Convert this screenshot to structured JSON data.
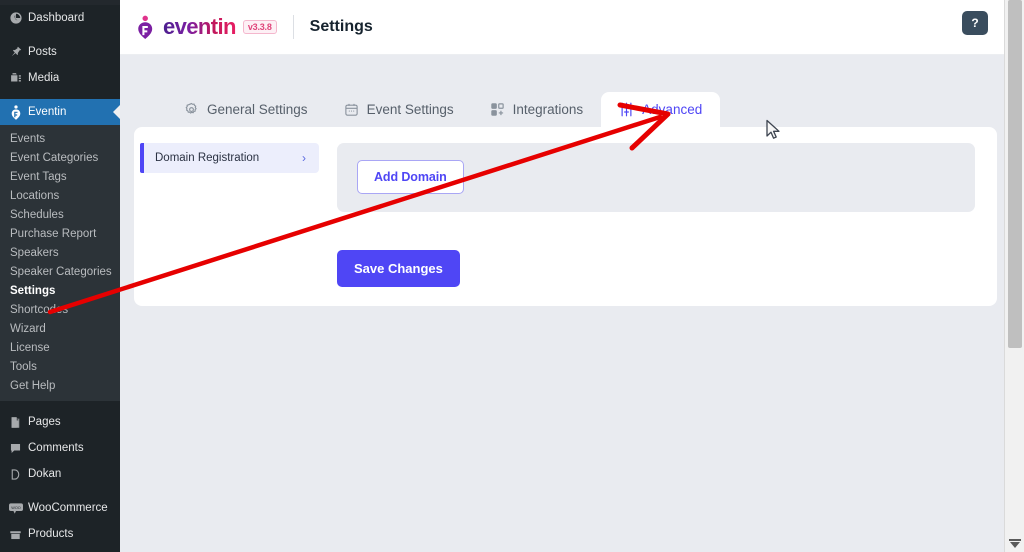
{
  "wp_sidebar": {
    "top_items": [
      {
        "label": "Dashboard",
        "icon": "dashboard-icon"
      },
      {
        "label": "Posts",
        "icon": "pin-icon"
      },
      {
        "label": "Media",
        "icon": "media-icon"
      }
    ],
    "current_item": {
      "label": "Eventin",
      "icon": "eventin-icon"
    },
    "submenu": [
      {
        "label": "Events",
        "active": false
      },
      {
        "label": "Event Categories",
        "active": false
      },
      {
        "label": "Event Tags",
        "active": false
      },
      {
        "label": "Locations",
        "active": false
      },
      {
        "label": "Schedules",
        "active": false
      },
      {
        "label": "Purchase Report",
        "active": false
      },
      {
        "label": "Speakers",
        "active": false
      },
      {
        "label": "Speaker Categories",
        "active": false
      },
      {
        "label": "Settings",
        "active": true
      },
      {
        "label": "Shortcodes",
        "active": false
      },
      {
        "label": "Wizard",
        "active": false
      },
      {
        "label": "License",
        "active": false
      },
      {
        "label": "Tools",
        "active": false
      },
      {
        "label": "Get Help",
        "active": false
      }
    ],
    "bottom_items": [
      {
        "label": "Pages",
        "icon": "pages-icon"
      },
      {
        "label": "Comments",
        "icon": "comment-icon"
      },
      {
        "label": "Dokan",
        "icon": "dokan-icon"
      },
      {
        "label": "WooCommerce",
        "icon": "woocommerce-icon"
      },
      {
        "label": "Products",
        "icon": "products-icon"
      }
    ]
  },
  "header": {
    "logo_text": "eventin",
    "version": "v3.3.8",
    "title": "Settings",
    "help_glyph": "?"
  },
  "tabs": [
    {
      "label": "General Settings",
      "icon": "gear-icon",
      "active": false
    },
    {
      "label": "Event Settings",
      "icon": "calendar-icon",
      "active": false
    },
    {
      "label": "Integrations",
      "icon": "grid-plus-icon",
      "active": false
    },
    {
      "label": "Advanced",
      "icon": "sliders-icon",
      "active": true
    }
  ],
  "settings_nav": [
    {
      "label": "Domain Registration",
      "chevron": "›",
      "active": true
    }
  ],
  "panel": {
    "add_domain_label": "Add Domain"
  },
  "actions": {
    "save_label": "Save Changes"
  },
  "colors": {
    "accent": "#4f46f5",
    "wp_current": "#2271b1",
    "annotation": "#e60000",
    "page_bg": "#e9ebf0"
  }
}
